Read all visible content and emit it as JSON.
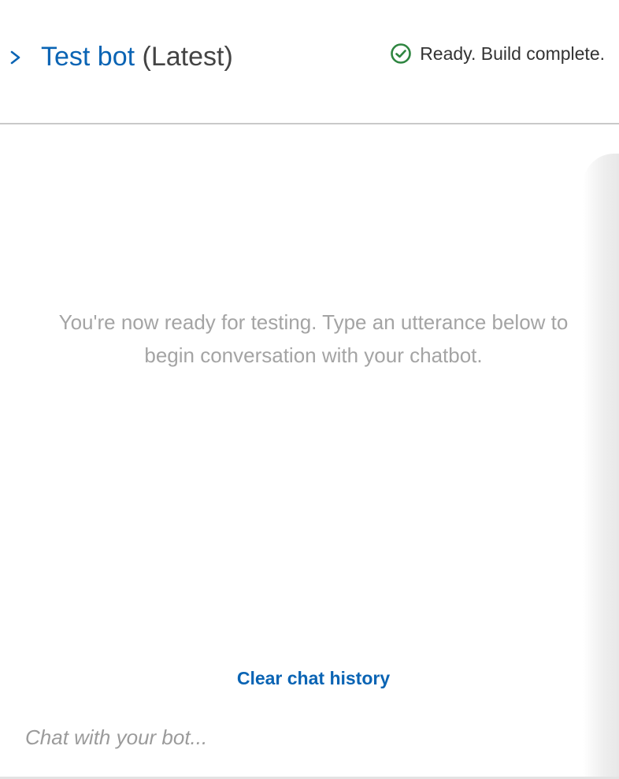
{
  "header": {
    "title_link": "Test bot",
    "title_suffix": "(Latest)",
    "expand_icon": "chevron-right-icon",
    "status": {
      "icon": "check-circle-icon",
      "text": "Ready. Build complete.",
      "color": "#2e8540"
    }
  },
  "chat": {
    "empty_message": "You're now ready for testing. Type an utterance below to begin conversation with your chatbot.",
    "clear_label": "Clear chat history",
    "input_value": "",
    "input_placeholder": "Chat with your bot..."
  },
  "colors": {
    "link": "#0a64b4",
    "muted_text": "#a4a4a4",
    "divider": "#c9c9c9"
  }
}
